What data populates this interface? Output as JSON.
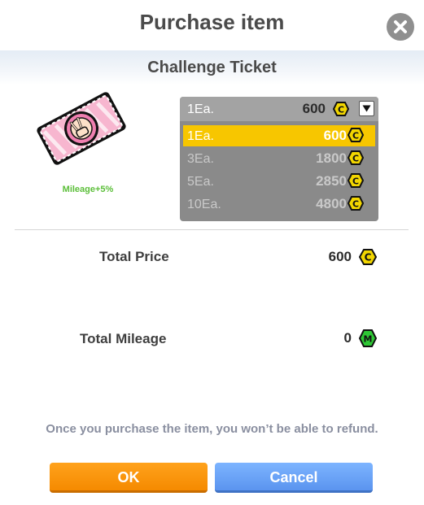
{
  "dialog": {
    "title": "Purchase item",
    "subtitle": "Challenge Ticket",
    "close_icon": "close-icon"
  },
  "item": {
    "icon": "peace-hand-ticket-icon",
    "mileage_label": "Mileage+5%"
  },
  "quantity": {
    "selected_label": "1Ea.",
    "selected_price": "600",
    "options": [
      {
        "label": "1Ea.",
        "price": "600",
        "selected": true
      },
      {
        "label": "3Ea.",
        "price": "1800",
        "selected": false
      },
      {
        "label": "5Ea.",
        "price": "2850",
        "selected": false
      },
      {
        "label": "10Ea.",
        "price": "4800",
        "selected": false
      }
    ],
    "currency_icon": "coin-c-icon",
    "caret_icon": "dropdown-arrow-icon"
  },
  "totals": {
    "price_label": "Total Price",
    "price_value": "600",
    "price_currency_icon": "coin-c-icon",
    "mileage_label": "Total Mileage",
    "mileage_value": "0",
    "mileage_currency_icon": "coin-m-icon"
  },
  "notice": "Once you purchase the item, you won’t be able to refund.",
  "buttons": {
    "ok": "OK",
    "cancel": "Cancel"
  },
  "colors": {
    "ok_button": "#f58a00",
    "cancel_button": "#5b94ef",
    "selected_option": "#f7c600",
    "mileage_green": "#5cbf3a",
    "coin_yellow": "#f2d600",
    "coin_green": "#2ec735"
  }
}
